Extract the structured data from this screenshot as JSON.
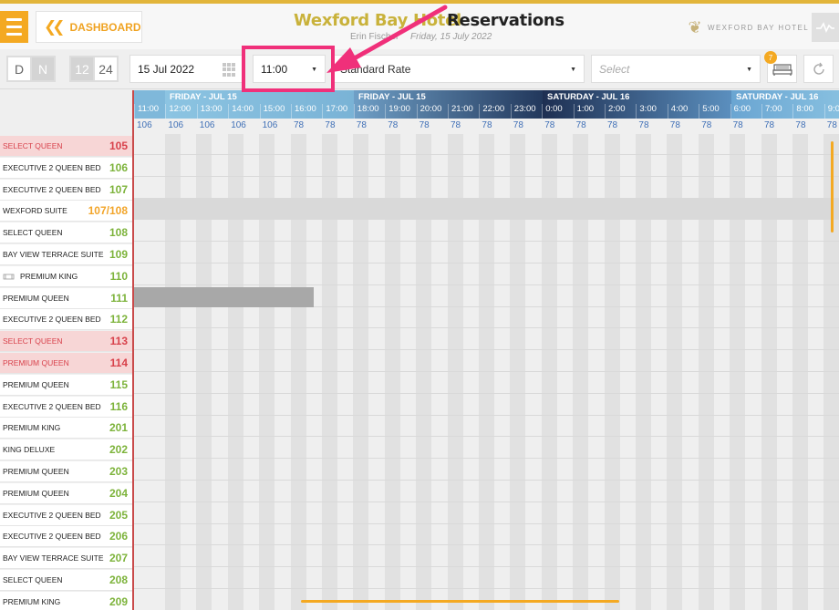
{
  "header": {
    "dashboard_label": "DASHBOARD",
    "hotel_name": "Wexford Bay Hotel",
    "page_title": "Reservations",
    "user_name": "Erin Fischer",
    "current_date": "Friday, 15 July 2022",
    "logo_text": "WEXFORD BAY HOTEL"
  },
  "toolbar": {
    "day_label": "D",
    "night_label": "N",
    "h12_label": "12",
    "h24_label": "24",
    "date_value": "15 Jul 2022",
    "time_value": "11:00",
    "rate_value": "Standard Rate",
    "select_placeholder": "Select",
    "badge_count": "7"
  },
  "timeline": {
    "days": [
      "FRIDAY - JUL 15",
      "FRIDAY - JUL 15",
      "SATURDAY - JUL 16",
      "SATURDAY - JUL 16"
    ],
    "hours": [
      "11:00",
      "12:00",
      "13:00",
      "14:00",
      "15:00",
      "16:00",
      "17:00",
      "18:00",
      "19:00",
      "20:00",
      "21:00",
      "22:00",
      "23:00",
      "0:00",
      "1:00",
      "2:00",
      "3:00",
      "4:00",
      "5:00",
      "6:00",
      "7:00",
      "8:00",
      "9:0"
    ],
    "availability": [
      "106",
      "106",
      "106",
      "106",
      "106",
      "78",
      "78",
      "78",
      "78",
      "78",
      "78",
      "78",
      "78",
      "78",
      "78",
      "78",
      "78",
      "78",
      "78",
      "78",
      "78",
      "78",
      "78"
    ]
  },
  "rooms": [
    {
      "type": "SELECT QUEEN",
      "number": "105",
      "state": "selected"
    },
    {
      "type": "EXECUTIVE 2 QUEEN BED",
      "number": "106"
    },
    {
      "type": "EXECUTIVE 2 QUEEN BED",
      "number": "107"
    },
    {
      "type": "WEXFORD SUITE",
      "number": "107/108",
      "state": "suite"
    },
    {
      "type": "SELECT QUEEN",
      "number": "108"
    },
    {
      "type": "BAY VIEW TERRACE SUITE",
      "number": "109"
    },
    {
      "type": "PREMIUM KING",
      "number": "110",
      "icon": "sofa-icon"
    },
    {
      "type": "PREMIUM QUEEN",
      "number": "111"
    },
    {
      "type": "EXECUTIVE 2 QUEEN BED",
      "number": "112"
    },
    {
      "type": "SELECT QUEEN",
      "number": "113",
      "state": "selected"
    },
    {
      "type": "PREMIUM QUEEN",
      "number": "114",
      "state": "selected"
    },
    {
      "type": "PREMIUM QUEEN",
      "number": "115"
    },
    {
      "type": "EXECUTIVE 2 QUEEN BED",
      "number": "116"
    },
    {
      "type": "PREMIUM KING",
      "number": "201"
    },
    {
      "type": "KING DELUXE",
      "number": "202"
    },
    {
      "type": "PREMIUM QUEEN",
      "number": "203"
    },
    {
      "type": "PREMIUM QUEEN",
      "number": "204"
    },
    {
      "type": "EXECUTIVE 2 QUEEN BED",
      "number": "205"
    },
    {
      "type": "EXECUTIVE 2 QUEEN BED",
      "number": "206"
    },
    {
      "type": "BAY VIEW TERRACE SUITE",
      "number": "207"
    },
    {
      "type": "SELECT QUEEN",
      "number": "208"
    },
    {
      "type": "PREMIUM KING",
      "number": "209"
    }
  ],
  "colors": {
    "accent": "#f4a922",
    "brand_gold": "#c9b23b",
    "room_number_green": "#7db33b",
    "selected_red": "#d8414b",
    "highlight_pink": "#f0307a"
  }
}
